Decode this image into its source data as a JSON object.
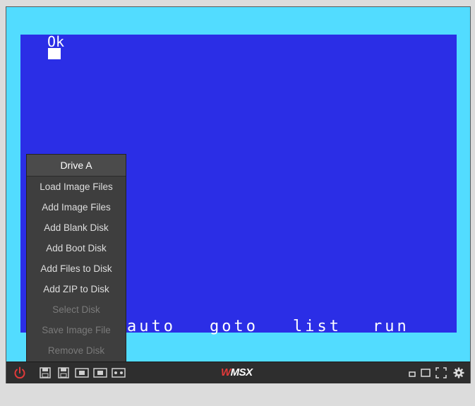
{
  "screen": {
    "prompt_text": "Ok",
    "function_keys": [
      "auto",
      "goto",
      "list",
      "run"
    ]
  },
  "drive_menu": {
    "title": "Drive A",
    "items": [
      {
        "label": "Load Image Files",
        "enabled": true
      },
      {
        "label": "Add Image Files",
        "enabled": true
      },
      {
        "label": "Add Blank Disk",
        "enabled": true
      },
      {
        "label": "Add Boot Disk",
        "enabled": true
      },
      {
        "label": "Add Files to Disk",
        "enabled": true
      },
      {
        "label": "Add ZIP to Disk",
        "enabled": true
      },
      {
        "label": "Select Disk",
        "enabled": false
      },
      {
        "label": "Save Image File",
        "enabled": false
      },
      {
        "label": "Remove Disk",
        "enabled": false
      }
    ]
  },
  "toolbar": {
    "logo_prefix": "W",
    "logo_text": "MSX",
    "left_icons": [
      "power-icon",
      "drive-a-icon",
      "drive-b-icon",
      "cartridge-1-icon",
      "cartridge-2-icon",
      "cassette-icon"
    ],
    "right_icons": [
      "small-window-icon",
      "window-icon",
      "fullscreen-icon",
      "settings-icon"
    ]
  },
  "colors": {
    "border": "#52dcff",
    "screen": "#2b2ee6",
    "toolbar": "#2e2e2e",
    "menu": "#3e3e3e",
    "power": "#e23a3a"
  }
}
